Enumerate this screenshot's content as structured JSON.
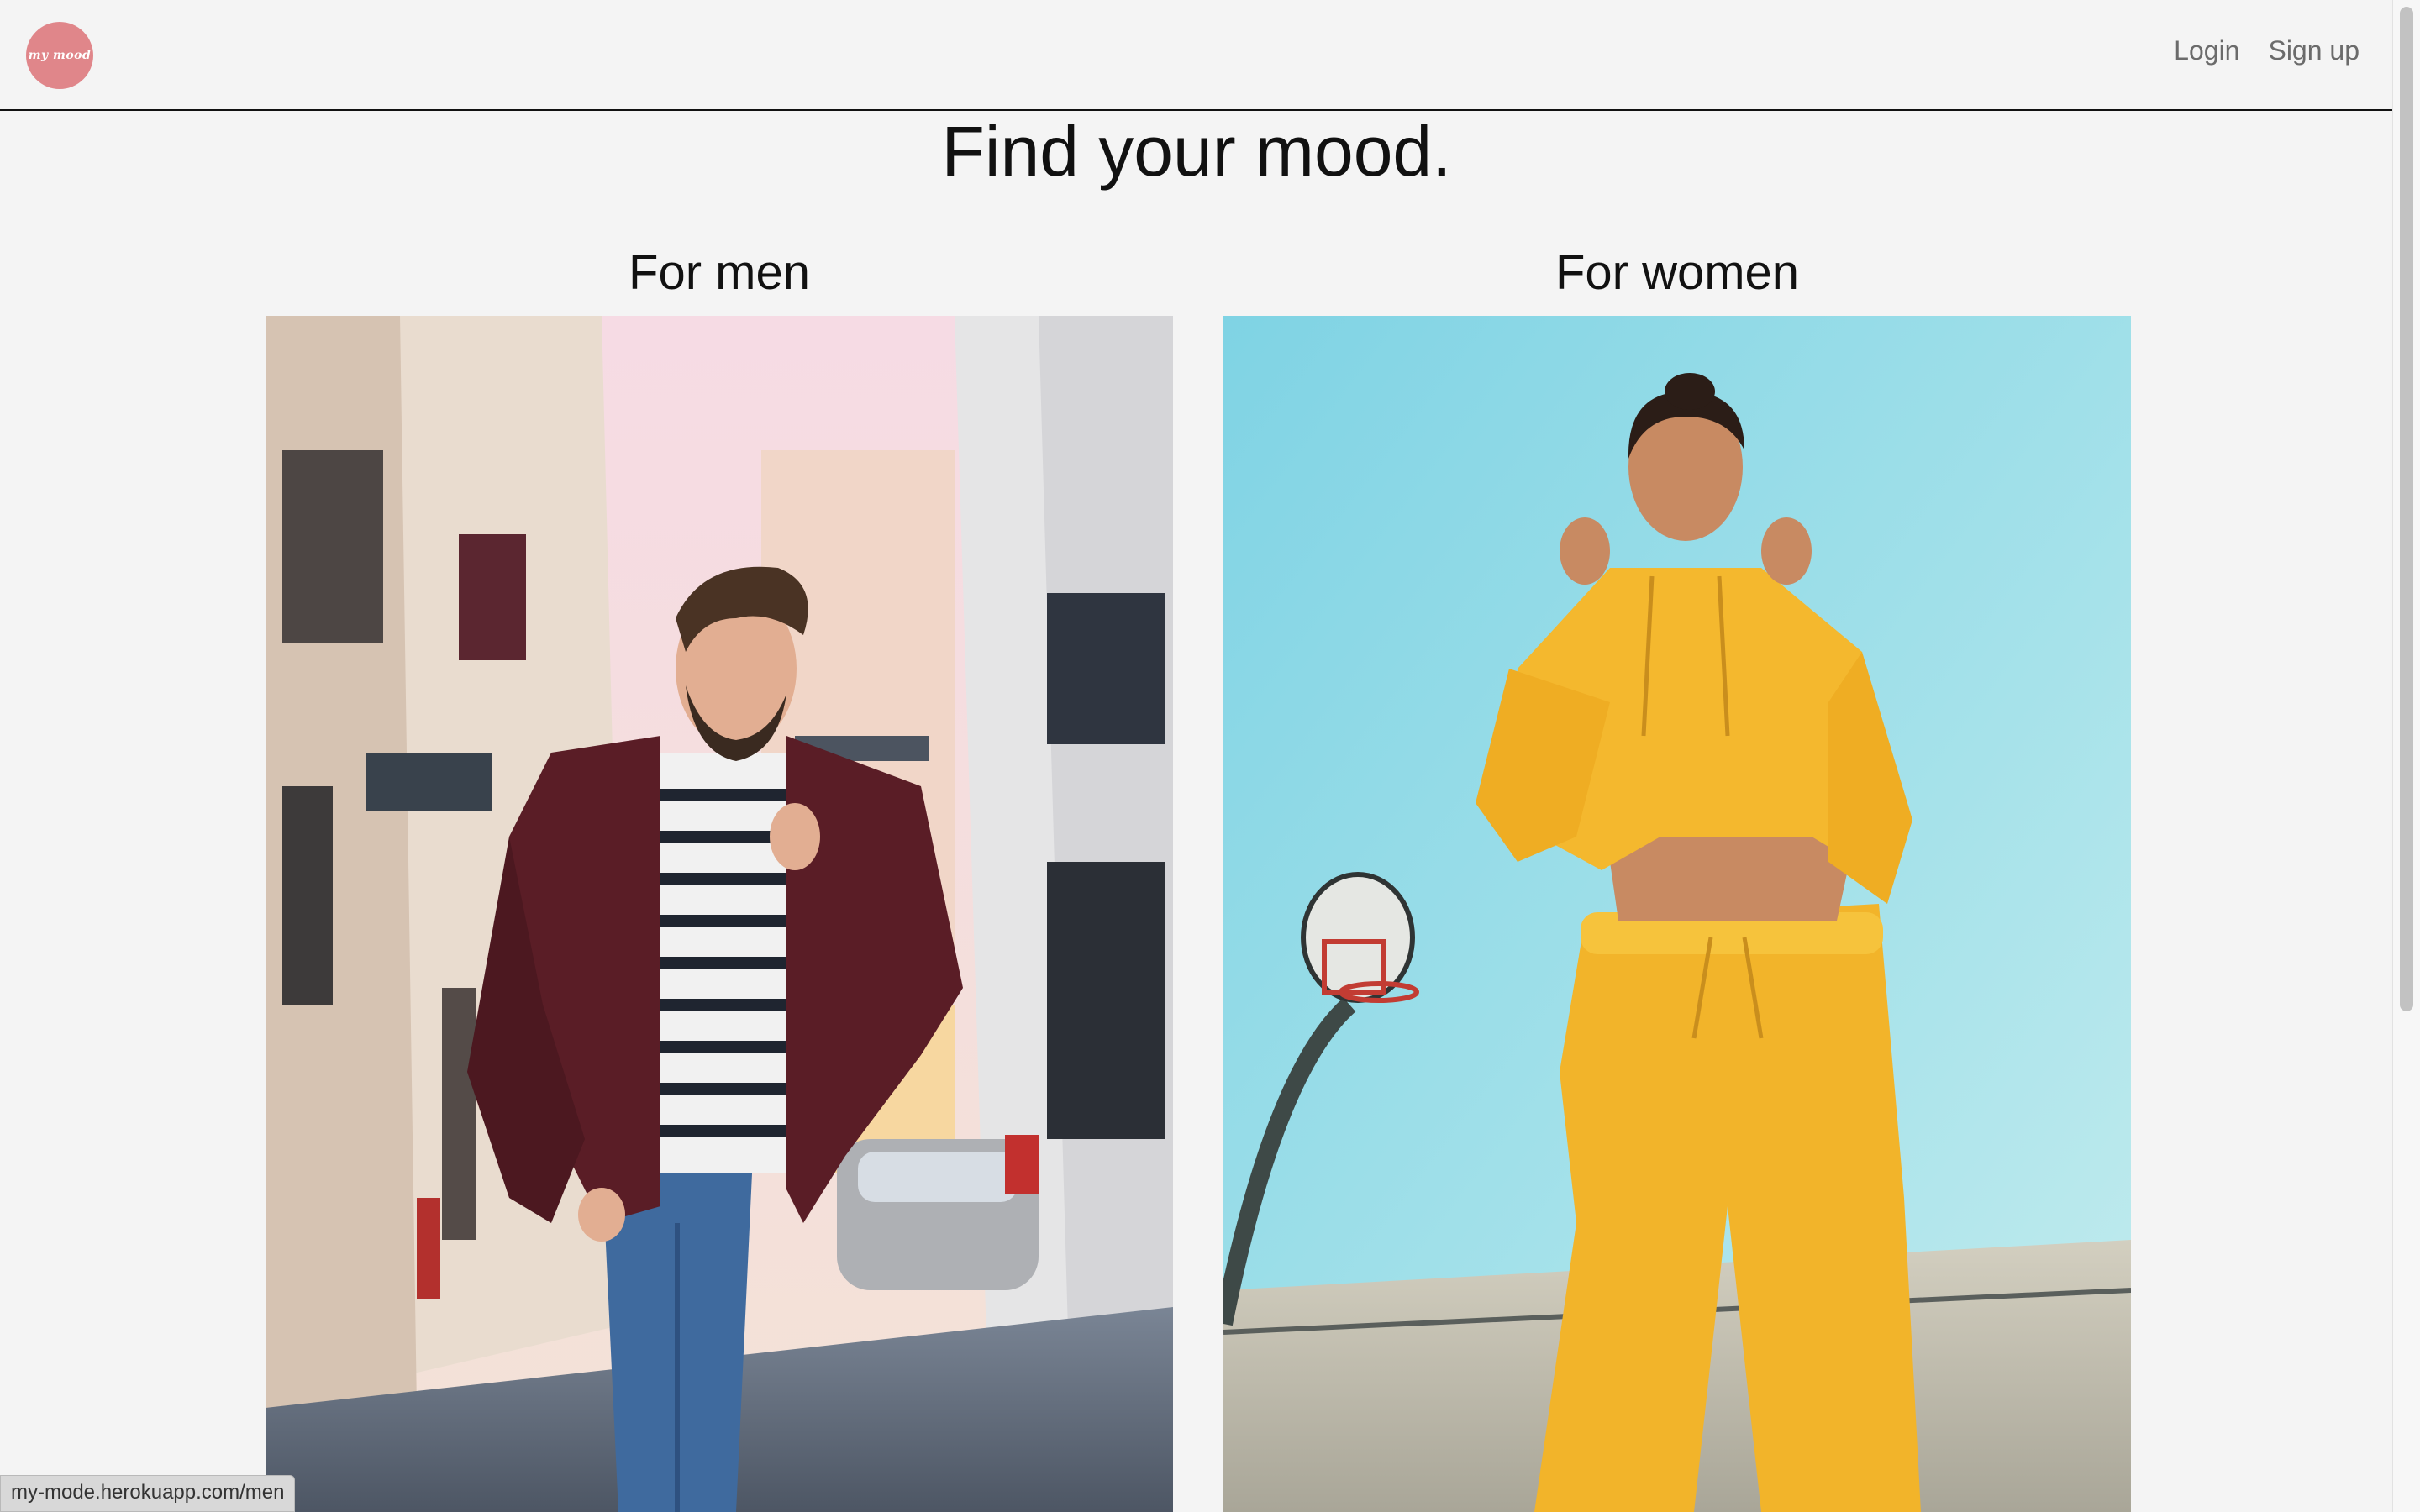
{
  "brand": {
    "logo_text": "my mood",
    "logo_color": "#e0868a"
  },
  "nav": {
    "login_label": "Login",
    "signup_label": "Sign up"
  },
  "hero": {
    "title": "Find your mood."
  },
  "sections": [
    {
      "title": "For men",
      "image_icon": "man-in-street-photo"
    },
    {
      "title": "For women",
      "image_icon": "woman-yellow-tracksuit-photo"
    }
  ],
  "status_bar": {
    "url": "my-mode.herokuapp.com/men"
  },
  "colors": {
    "background": "#f4f4f4",
    "text": "#111111",
    "nav_text": "#6b6b6b"
  }
}
